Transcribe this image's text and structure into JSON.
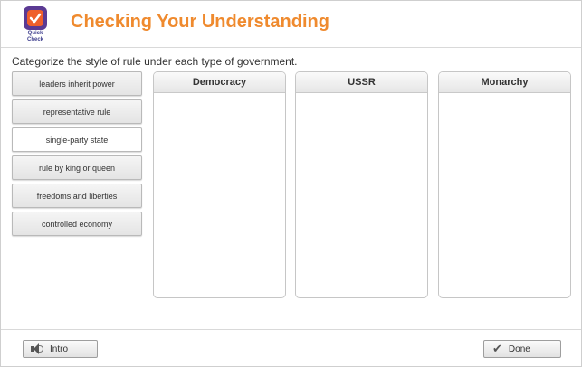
{
  "header": {
    "badge_line1": "Quick",
    "badge_line2": "Check",
    "title": "Checking Your Understanding",
    "title_color": "#ef8a2e",
    "badge_color": "#5b3a93"
  },
  "instruction": "Categorize the style of rule under each type of government.",
  "items": [
    {
      "label": "leaders inherit power"
    },
    {
      "label": "representative rule"
    },
    {
      "label": "single-party state"
    },
    {
      "label": "rule by king or queen"
    },
    {
      "label": "freedoms and liberties"
    },
    {
      "label": "controlled economy"
    }
  ],
  "columns": [
    {
      "heading": "Democracy"
    },
    {
      "heading": "USSR"
    },
    {
      "heading": "Monarchy"
    }
  ],
  "footer": {
    "intro_label": "Intro",
    "intro_icon": "speaker-icon",
    "done_label": "Done",
    "done_icon": "check-icon"
  }
}
